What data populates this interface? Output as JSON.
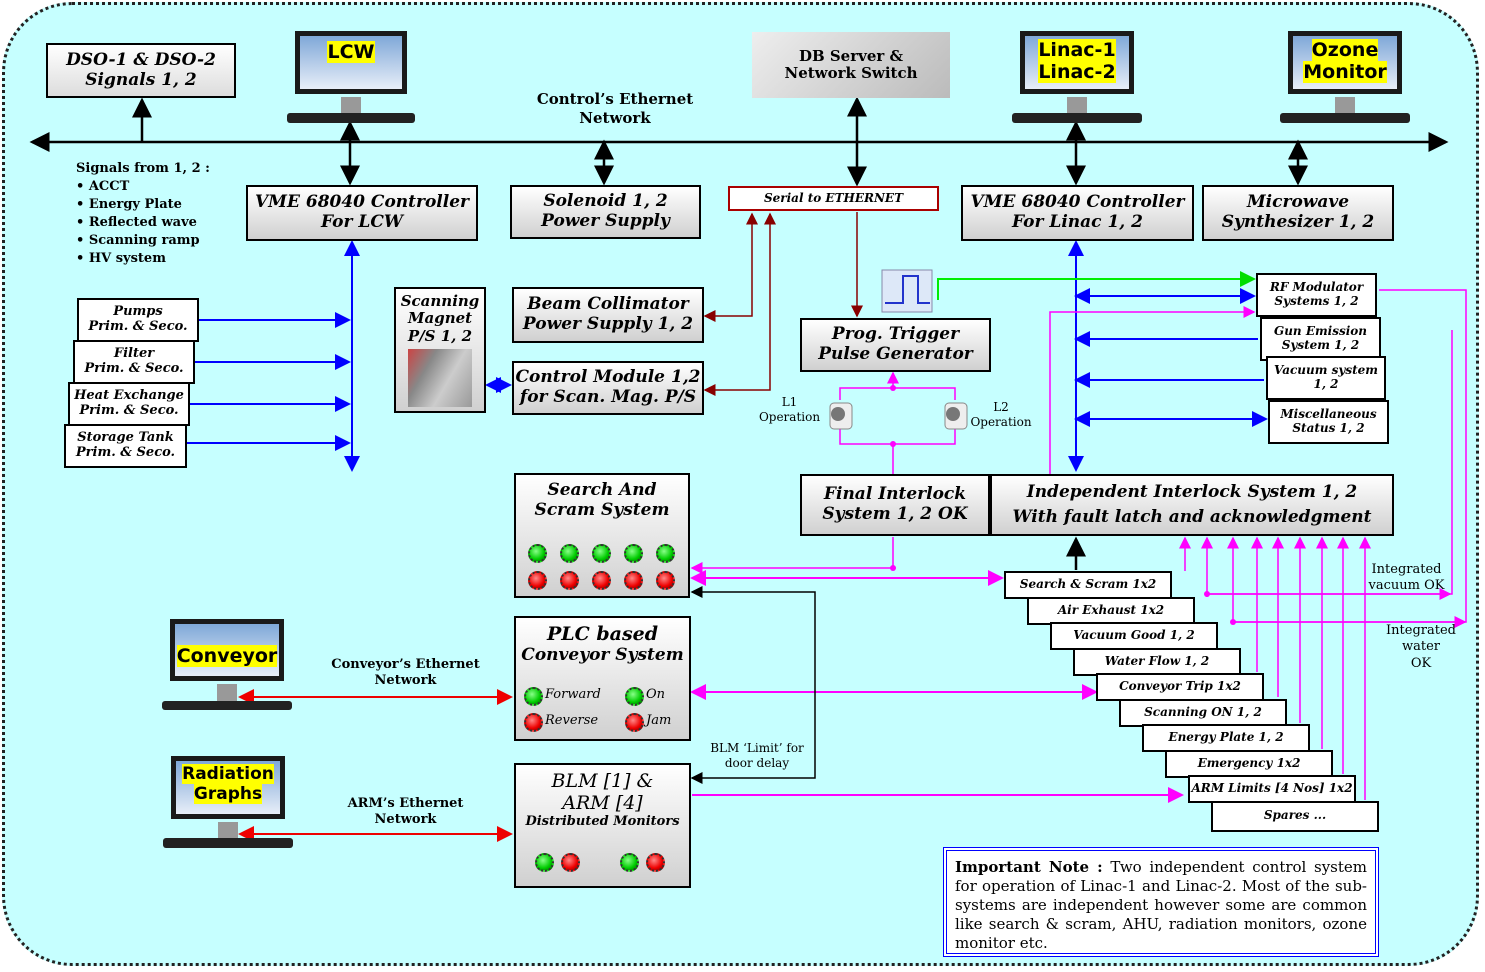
{
  "top": {
    "dso": [
      "DSO-1 & DSO-2",
      "Signals 1, 2"
    ],
    "lcw_monitor": "LCW",
    "db_server": [
      "DB Server &",
      "Network Switch"
    ],
    "linac_monitor": [
      "Linac-1",
      "Linac-2"
    ],
    "ozone_monitor": [
      "Ozone",
      "Monitor"
    ],
    "ethernet_label": [
      "Control’s Ethernet",
      "Network"
    ]
  },
  "signals": {
    "title": "Signals from 1, 2 :",
    "items": [
      "ACCT",
      "Energy Plate",
      "Reflected wave",
      "Scanning ramp",
      "HV system"
    ]
  },
  "vme_lcw": [
    "VME 68040 Controller",
    "For LCW"
  ],
  "solenoid": [
    "Solenoid 1, 2",
    "Power Supply"
  ],
  "serial": "Serial to ETHERNET",
  "vme_linac": [
    "VME 68040 Controller",
    "For Linac 1, 2"
  ],
  "microwave": [
    "Microwave",
    "Synthesizer 1, 2"
  ],
  "lcw_inputs": [
    [
      "Pumps",
      "Prim. & Seco."
    ],
    [
      "Filter",
      "Prim. & Seco."
    ],
    [
      "Heat Exchange",
      "Prim. & Seco."
    ],
    [
      "Storage Tank",
      "Prim. & Seco."
    ]
  ],
  "scanning_magnet": [
    "Scanning",
    "Magnet",
    "P/S 1, 2"
  ],
  "beam_collimator": [
    "Beam Collimator",
    "Power Supply 1, 2"
  ],
  "control_module": [
    "Control Module 1,2",
    "for Scan. Mag. P/S"
  ],
  "prog_trigger": [
    "Prog. Trigger",
    "Pulse Generator"
  ],
  "l1": [
    "L1",
    "Operation"
  ],
  "l2": [
    "L2",
    "Operation"
  ],
  "linac_inputs": [
    [
      "RF Modulator",
      "Systems 1, 2"
    ],
    [
      "Gun Emission",
      "System 1, 2"
    ],
    [
      "Vacuum system",
      "1, 2"
    ],
    [
      "Miscellaneous",
      "Status 1, 2"
    ]
  ],
  "final_interlock": [
    "Final Interlock",
    "System 1, 2 OK"
  ],
  "independent_interlock": [
    "Independent Interlock System 1, 2",
    "With fault latch and acknowledgment"
  ],
  "search_scram": [
    "Search And",
    "Scram System"
  ],
  "plc": {
    "title": [
      "PLC based",
      "Conveyor System"
    ],
    "forward": "Forward",
    "reverse": "Reverse",
    "on": "On",
    "jam": "Jam"
  },
  "blm": [
    "BLM [1] &",
    "ARM [4]",
    "Distributed Monitors"
  ],
  "conveyor_monitor": "Conveyor",
  "radiation_monitor": [
    "Radiation",
    "Graphs"
  ],
  "conveyor_net": [
    "Conveyor’s Ethernet",
    "Network"
  ],
  "arm_net": [
    "ARM’s Ethernet",
    "Network"
  ],
  "blm_limit": [
    "BLM ‘Limit’ for",
    "door delay"
  ],
  "interlock_inputs": [
    "Search & Scram 1x2",
    "Air Exhaust 1x2",
    "Vacuum Good 1, 2",
    "Water Flow 1, 2",
    "Conveyor Trip 1x2",
    "Scanning ON 1, 2",
    "Energy Plate 1, 2",
    "Emergency 1x2",
    "ARM Limits [4 Nos] 1x2",
    "Spares ..."
  ],
  "vacuum_ok": [
    "Integrated",
    "vacuum  OK"
  ],
  "water_ok": [
    "Integrated water",
    "OK"
  ],
  "note": {
    "heading": "Important Note :",
    "text": " Two independent control system for operation of Linac-1 and Linac-2. Most of the sub-systems are independent however some are common like search & scram, AHU, radiation monitors, ozone monitor etc."
  },
  "colors": {
    "background": "#c6ffff",
    "lcw_bus": "#0000ff",
    "interlock": "#ff00ff",
    "serial": "#800000",
    "trigger": "#00ff00",
    "conveyor_net": "#ff0000"
  }
}
